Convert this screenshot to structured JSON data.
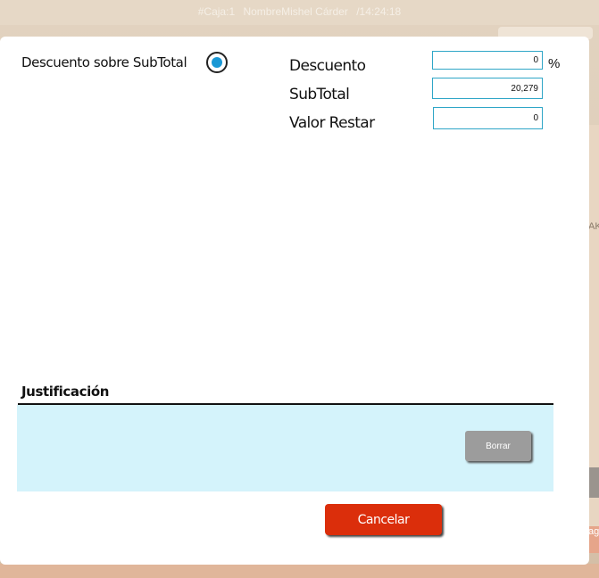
{
  "background": {
    "header": {
      "caja": "#Caja:1",
      "nombre": "NombreMishel Cárder",
      "time": "/14:24:18"
    },
    "right_partial_text": "AK",
    "right_orange_text": "ag"
  },
  "modal": {
    "discount_option_label": "Descuento sobre SubTotal",
    "fields": {
      "descuento": {
        "label": "Descuento",
        "value": "0",
        "unit": "%"
      },
      "subtotal": {
        "label": "SubTotal",
        "value": "20,279"
      },
      "valor_restar": {
        "label": "Valor Restar",
        "value": "0"
      }
    },
    "justificacion": {
      "title": "Justificación",
      "text": ""
    },
    "buttons": {
      "borrar": "Borrar",
      "cancelar": "Cancelar"
    }
  },
  "colors": {
    "accent_blue": "#1a98d5",
    "field_border": "#2fa6c7",
    "justification_bg": "#d4f3fb",
    "cancel_red": "#db2e0b",
    "borrar_gray": "#9c9c9c"
  }
}
